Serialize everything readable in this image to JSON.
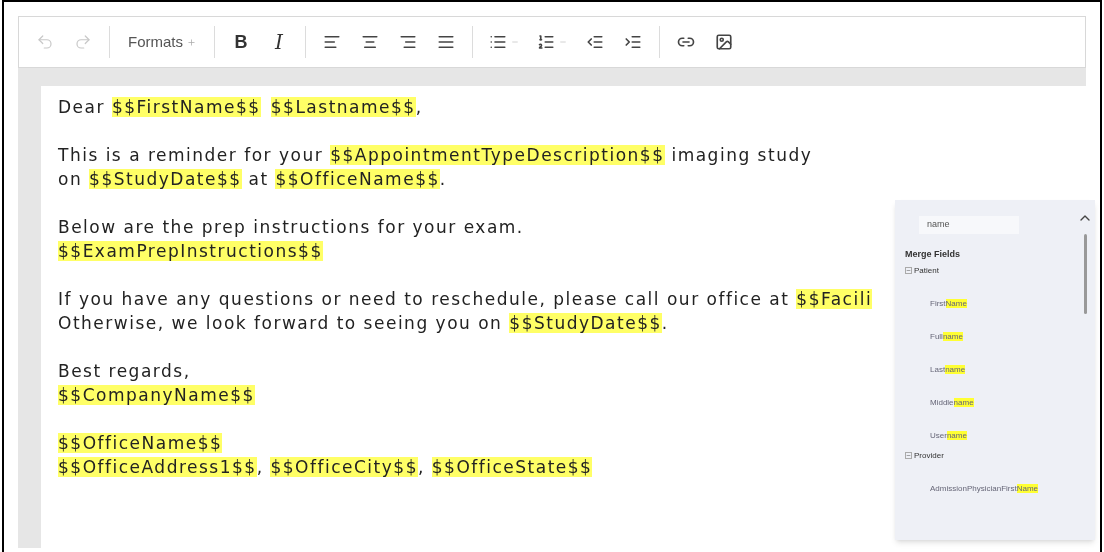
{
  "toolbar": [
    {
      "kind": "undo",
      "disabled": true
    },
    {
      "kind": "redo",
      "disabled": true
    },
    {
      "kind": "separator"
    },
    {
      "kind": "formats",
      "label": "Formats"
    },
    {
      "kind": "separator"
    },
    {
      "kind": "bold",
      "label": "B"
    },
    {
      "kind": "italic",
      "label": "I"
    },
    {
      "kind": "separator"
    },
    {
      "kind": "align-left"
    },
    {
      "kind": "align-center"
    },
    {
      "kind": "align-right"
    },
    {
      "kind": "align-justify"
    },
    {
      "kind": "separator"
    },
    {
      "kind": "bullet-list"
    },
    {
      "kind": "numbered-list"
    },
    {
      "kind": "outdent"
    },
    {
      "kind": "indent"
    },
    {
      "kind": "separator"
    },
    {
      "kind": "link"
    },
    {
      "kind": "image"
    }
  ],
  "document": {
    "paragraphs": [
      [
        [
          {
            "text": "Dear "
          },
          {
            "text": "$$FirstName$$",
            "merge": true
          },
          {
            "text": "$$Lastname$$",
            "merge": true,
            "space_before": true
          },
          {
            "text": ","
          }
        ]
      ],
      [
        [
          {
            "text": "This is a reminder for your "
          },
          {
            "text": "$$AppointmentTypeDescription$$",
            "merge": true
          },
          {
            "text": " imaging study"
          }
        ],
        [
          {
            "text": "on "
          },
          {
            "text": "$$StudyDate$$",
            "merge": true
          },
          {
            "text": " at "
          },
          {
            "text": "$$OfficeName$$",
            "merge": true
          },
          {
            "text": "."
          }
        ]
      ],
      [
        [
          {
            "text": "Below are the prep instructions for your exam."
          }
        ],
        [
          {
            "text": "$$ExamPrepInstructions$$",
            "merge": true
          }
        ]
      ],
      [
        [
          {
            "text": "If you have any questions or need to reschedule, please call our office at "
          },
          {
            "text": "$$Facili",
            "merge": true
          }
        ],
        [
          {
            "text": "Otherwise, we look forward to seeing you on "
          },
          {
            "text": "$$StudyDate$$",
            "merge": true
          },
          {
            "text": "."
          }
        ]
      ],
      [
        [
          {
            "text": "Best regards,"
          }
        ],
        [
          {
            "text": "$$CompanyName$$",
            "merge": true
          }
        ]
      ],
      [
        [
          {
            "text": "$$OfficeName$$",
            "merge": true
          }
        ],
        [
          {
            "text": "$$OfficeAddress1$$",
            "merge": true
          },
          {
            "text": ", "
          },
          {
            "text": "$$OfficeCity$$",
            "merge": true
          },
          {
            "text": ", "
          },
          {
            "text": "$$OfficeState$$",
            "merge": true
          }
        ]
      ]
    ]
  },
  "merge_panel": {
    "search": {
      "value": "name"
    },
    "title": "Merge Fields",
    "groups": [
      {
        "label": "Patient",
        "expanded": true,
        "fields": [
          {
            "label": "First",
            "match": "Name"
          },
          {
            "label": "Full",
            "match": "name"
          },
          {
            "label": "Last",
            "match": "name"
          },
          {
            "label": "Middle",
            "match": "name"
          },
          {
            "label": "User",
            "match": "name"
          }
        ]
      },
      {
        "label": "Provider",
        "expanded": true,
        "fields": [
          {
            "label": "AdmissionPhysicianFirst",
            "match": "Name"
          }
        ]
      }
    ]
  }
}
